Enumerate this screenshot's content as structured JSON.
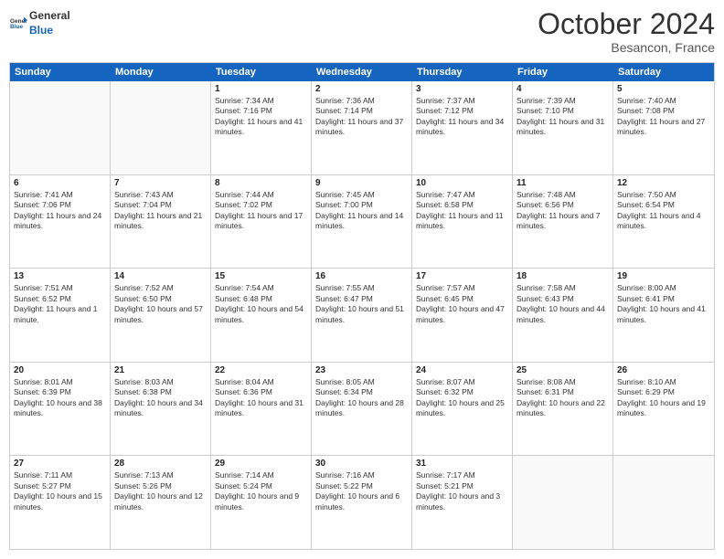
{
  "header": {
    "logo_line1": "General",
    "logo_line2": "Blue",
    "month": "October 2024",
    "location": "Besancon, France"
  },
  "days_of_week": [
    "Sunday",
    "Monday",
    "Tuesday",
    "Wednesday",
    "Thursday",
    "Friday",
    "Saturday"
  ],
  "weeks": [
    [
      {
        "day": "",
        "sunrise": "",
        "sunset": "",
        "daylight": "",
        "empty": true
      },
      {
        "day": "",
        "sunrise": "",
        "sunset": "",
        "daylight": "",
        "empty": true
      },
      {
        "day": "1",
        "sunrise": "Sunrise: 7:34 AM",
        "sunset": "Sunset: 7:16 PM",
        "daylight": "Daylight: 11 hours and 41 minutes."
      },
      {
        "day": "2",
        "sunrise": "Sunrise: 7:36 AM",
        "sunset": "Sunset: 7:14 PM",
        "daylight": "Daylight: 11 hours and 37 minutes."
      },
      {
        "day": "3",
        "sunrise": "Sunrise: 7:37 AM",
        "sunset": "Sunset: 7:12 PM",
        "daylight": "Daylight: 11 hours and 34 minutes."
      },
      {
        "day": "4",
        "sunrise": "Sunrise: 7:39 AM",
        "sunset": "Sunset: 7:10 PM",
        "daylight": "Daylight: 11 hours and 31 minutes."
      },
      {
        "day": "5",
        "sunrise": "Sunrise: 7:40 AM",
        "sunset": "Sunset: 7:08 PM",
        "daylight": "Daylight: 11 hours and 27 minutes."
      }
    ],
    [
      {
        "day": "6",
        "sunrise": "Sunrise: 7:41 AM",
        "sunset": "Sunset: 7:06 PM",
        "daylight": "Daylight: 11 hours and 24 minutes."
      },
      {
        "day": "7",
        "sunrise": "Sunrise: 7:43 AM",
        "sunset": "Sunset: 7:04 PM",
        "daylight": "Daylight: 11 hours and 21 minutes."
      },
      {
        "day": "8",
        "sunrise": "Sunrise: 7:44 AM",
        "sunset": "Sunset: 7:02 PM",
        "daylight": "Daylight: 11 hours and 17 minutes."
      },
      {
        "day": "9",
        "sunrise": "Sunrise: 7:45 AM",
        "sunset": "Sunset: 7:00 PM",
        "daylight": "Daylight: 11 hours and 14 minutes."
      },
      {
        "day": "10",
        "sunrise": "Sunrise: 7:47 AM",
        "sunset": "Sunset: 6:58 PM",
        "daylight": "Daylight: 11 hours and 11 minutes."
      },
      {
        "day": "11",
        "sunrise": "Sunrise: 7:48 AM",
        "sunset": "Sunset: 6:56 PM",
        "daylight": "Daylight: 11 hours and 7 minutes."
      },
      {
        "day": "12",
        "sunrise": "Sunrise: 7:50 AM",
        "sunset": "Sunset: 6:54 PM",
        "daylight": "Daylight: 11 hours and 4 minutes."
      }
    ],
    [
      {
        "day": "13",
        "sunrise": "Sunrise: 7:51 AM",
        "sunset": "Sunset: 6:52 PM",
        "daylight": "Daylight: 11 hours and 1 minute."
      },
      {
        "day": "14",
        "sunrise": "Sunrise: 7:52 AM",
        "sunset": "Sunset: 6:50 PM",
        "daylight": "Daylight: 10 hours and 57 minutes."
      },
      {
        "day": "15",
        "sunrise": "Sunrise: 7:54 AM",
        "sunset": "Sunset: 6:48 PM",
        "daylight": "Daylight: 10 hours and 54 minutes."
      },
      {
        "day": "16",
        "sunrise": "Sunrise: 7:55 AM",
        "sunset": "Sunset: 6:47 PM",
        "daylight": "Daylight: 10 hours and 51 minutes."
      },
      {
        "day": "17",
        "sunrise": "Sunrise: 7:57 AM",
        "sunset": "Sunset: 6:45 PM",
        "daylight": "Daylight: 10 hours and 47 minutes."
      },
      {
        "day": "18",
        "sunrise": "Sunrise: 7:58 AM",
        "sunset": "Sunset: 6:43 PM",
        "daylight": "Daylight: 10 hours and 44 minutes."
      },
      {
        "day": "19",
        "sunrise": "Sunrise: 8:00 AM",
        "sunset": "Sunset: 6:41 PM",
        "daylight": "Daylight: 10 hours and 41 minutes."
      }
    ],
    [
      {
        "day": "20",
        "sunrise": "Sunrise: 8:01 AM",
        "sunset": "Sunset: 6:39 PM",
        "daylight": "Daylight: 10 hours and 38 minutes."
      },
      {
        "day": "21",
        "sunrise": "Sunrise: 8:03 AM",
        "sunset": "Sunset: 6:38 PM",
        "daylight": "Daylight: 10 hours and 34 minutes."
      },
      {
        "day": "22",
        "sunrise": "Sunrise: 8:04 AM",
        "sunset": "Sunset: 6:36 PM",
        "daylight": "Daylight: 10 hours and 31 minutes."
      },
      {
        "day": "23",
        "sunrise": "Sunrise: 8:05 AM",
        "sunset": "Sunset: 6:34 PM",
        "daylight": "Daylight: 10 hours and 28 minutes."
      },
      {
        "day": "24",
        "sunrise": "Sunrise: 8:07 AM",
        "sunset": "Sunset: 6:32 PM",
        "daylight": "Daylight: 10 hours and 25 minutes."
      },
      {
        "day": "25",
        "sunrise": "Sunrise: 8:08 AM",
        "sunset": "Sunset: 6:31 PM",
        "daylight": "Daylight: 10 hours and 22 minutes."
      },
      {
        "day": "26",
        "sunrise": "Sunrise: 8:10 AM",
        "sunset": "Sunset: 6:29 PM",
        "daylight": "Daylight: 10 hours and 19 minutes."
      }
    ],
    [
      {
        "day": "27",
        "sunrise": "Sunrise: 7:11 AM",
        "sunset": "Sunset: 5:27 PM",
        "daylight": "Daylight: 10 hours and 15 minutes."
      },
      {
        "day": "28",
        "sunrise": "Sunrise: 7:13 AM",
        "sunset": "Sunset: 5:26 PM",
        "daylight": "Daylight: 10 hours and 12 minutes."
      },
      {
        "day": "29",
        "sunrise": "Sunrise: 7:14 AM",
        "sunset": "Sunset: 5:24 PM",
        "daylight": "Daylight: 10 hours and 9 minutes."
      },
      {
        "day": "30",
        "sunrise": "Sunrise: 7:16 AM",
        "sunset": "Sunset: 5:22 PM",
        "daylight": "Daylight: 10 hours and 6 minutes."
      },
      {
        "day": "31",
        "sunrise": "Sunrise: 7:17 AM",
        "sunset": "Sunset: 5:21 PM",
        "daylight": "Daylight: 10 hours and 3 minutes."
      },
      {
        "day": "",
        "sunrise": "",
        "sunset": "",
        "daylight": "",
        "empty": true
      },
      {
        "day": "",
        "sunrise": "",
        "sunset": "",
        "daylight": "",
        "empty": true
      }
    ]
  ]
}
